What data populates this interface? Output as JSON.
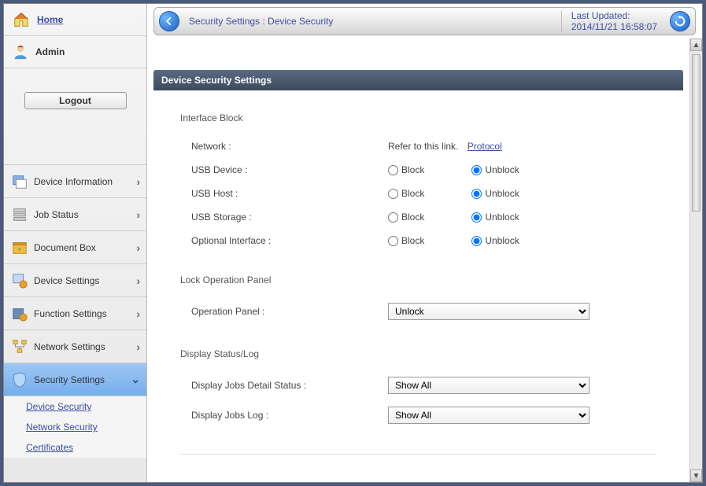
{
  "sidebar": {
    "home_label": "Home",
    "admin_label": "Admin",
    "logout_label": "Logout",
    "items": [
      {
        "label": "Device Information"
      },
      {
        "label": "Job Status"
      },
      {
        "label": "Document Box"
      },
      {
        "label": "Device Settings"
      },
      {
        "label": "Function Settings"
      },
      {
        "label": "Network Settings"
      },
      {
        "label": "Security Settings"
      }
    ],
    "subitems": [
      {
        "label": "Device Security"
      },
      {
        "label": "Network Security"
      },
      {
        "label": "Certificates"
      }
    ]
  },
  "topbar": {
    "breadcrumb": "Security Settings : Device Security",
    "last_updated_label": "Last Updated:",
    "last_updated_value": "2014/11/21 16:58:07"
  },
  "panel": {
    "title": "Device Security Settings",
    "interface_block_title": "Interface Block",
    "network_label": "Network :",
    "network_refer": "Refer to this link.",
    "network_link": "Protocol",
    "usb_device_label": "USB Device :",
    "usb_host_label": "USB Host :",
    "usb_storage_label": "USB Storage :",
    "optional_interface_label": "Optional Interface :",
    "block_label": "Block",
    "unblock_label": "Unblock",
    "lock_panel_title": "Lock Operation Panel",
    "operation_panel_label": "Operation Panel :",
    "operation_panel_value": "Unlock",
    "display_status_title": "Display Status/Log",
    "jobs_detail_label": "Display Jobs Detail Status :",
    "jobs_detail_value": "Show All",
    "jobs_log_label": "Display Jobs Log :",
    "jobs_log_value": "Show All"
  }
}
